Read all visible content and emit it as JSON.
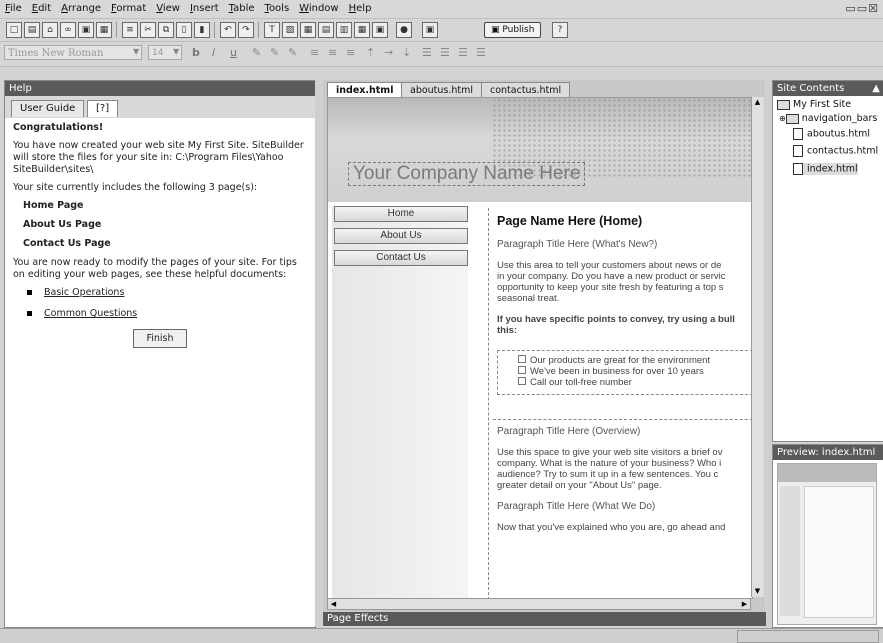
{
  "menu": [
    "File",
    "Edit",
    "Arrange",
    "Format",
    "View",
    "Insert",
    "Table",
    "Tools",
    "Window",
    "Help"
  ],
  "format_toolbar": {
    "font": "Times New Roman",
    "size": "14",
    "publish_label": "Publish"
  },
  "help_panel": {
    "title": "Help",
    "tabs": {
      "user_guide": "User Guide",
      "help_icon": "[?]"
    },
    "heading": "Congratulations!",
    "intro": "You have now created your web site My First Site. SiteBuilder will store the files for your site in: C:\\Program Files\\Yahoo SiteBuilder\\sites\\",
    "pages_line": "Your site currently includes the following 3 page(s):",
    "pages": [
      "Home Page",
      "About Us Page",
      "Contact Us Page"
    ],
    "ready_text": "You are now ready to modify the pages of your site. For tips on editing your web pages, see these helpful documents:",
    "links": [
      "Basic Operations",
      "Common Questions"
    ],
    "finish": "Finish"
  },
  "editor": {
    "tabs": [
      "index.html",
      "aboutus.html",
      "contactus.html"
    ],
    "company_name": "Your Company Name Here",
    "nav": [
      "Home",
      "About Us",
      "Contact Us"
    ],
    "page_title": "Page Name Here (Home)",
    "sec1_title": "Paragraph Title Here (What's New?)",
    "sec1_lines": [
      "Use this area to tell your customers about news or de",
      "in your company. Do you have a new product or servic",
      "opportunity to keep your site fresh by featuring a top s",
      "seasonal treat."
    ],
    "sec2_lines": [
      "If you have specific points to convey, try using a bull",
      "this:"
    ],
    "bullets": [
      "Our products are great for the environment",
      "We've been in business for over 10 years",
      "Call our toll-free number"
    ],
    "sec3_title": "Paragraph Title Here (Overview)",
    "sec3_lines": [
      "Use this space to give your web site visitors a brief ov",
      "company. What is the nature of your business? Who i",
      "audience? Try to sum it up in a few sentences. You c",
      "greater detail on your \"About Us\" page."
    ],
    "sec4_title": "Paragraph Title Here (What We Do)",
    "sec4_line": "Now that you've explained who you are, go ahead and"
  },
  "page_effects": "Page Effects",
  "site_contents": {
    "title": "Site Contents",
    "root": "My First Site",
    "items": [
      "navigation_bars",
      "aboutus.html",
      "contactus.html",
      "index.html"
    ]
  },
  "preview": {
    "title": "Preview: index.html"
  }
}
